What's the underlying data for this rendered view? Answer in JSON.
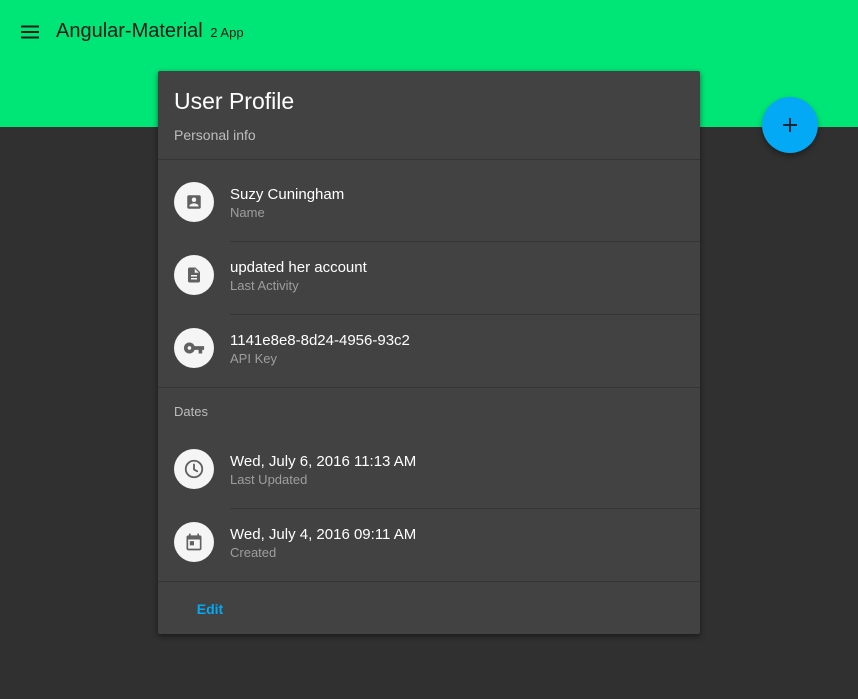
{
  "app": {
    "title": "Angular-Material",
    "title_suffix": "2 App",
    "menu_icon": "menu-icon",
    "fab_icon": "add-icon"
  },
  "colors": {
    "toolbar": "#00e676",
    "background": "#303030",
    "card": "#424242",
    "accent": "#03a9f4"
  },
  "card": {
    "title": "User Profile",
    "subtitle": "Personal info",
    "personal_items": [
      {
        "icon": "contact-card-icon",
        "primary": "Suzy Cuningham",
        "secondary": "Name"
      },
      {
        "icon": "document-icon",
        "primary": "updated her account",
        "secondary": "Last Activity"
      },
      {
        "icon": "key-icon",
        "primary": "1141e8e8-8d24-4956-93c2",
        "secondary": "API Key"
      }
    ],
    "dates_header": "Dates",
    "date_items": [
      {
        "icon": "clock-icon",
        "primary": "Wed, July 6, 2016 11:13 AM",
        "secondary": "Last Updated"
      },
      {
        "icon": "calendar-icon",
        "primary": "Wed, July 4, 2016 09:11 AM",
        "secondary": "Created"
      }
    ],
    "edit_label": "Edit"
  }
}
